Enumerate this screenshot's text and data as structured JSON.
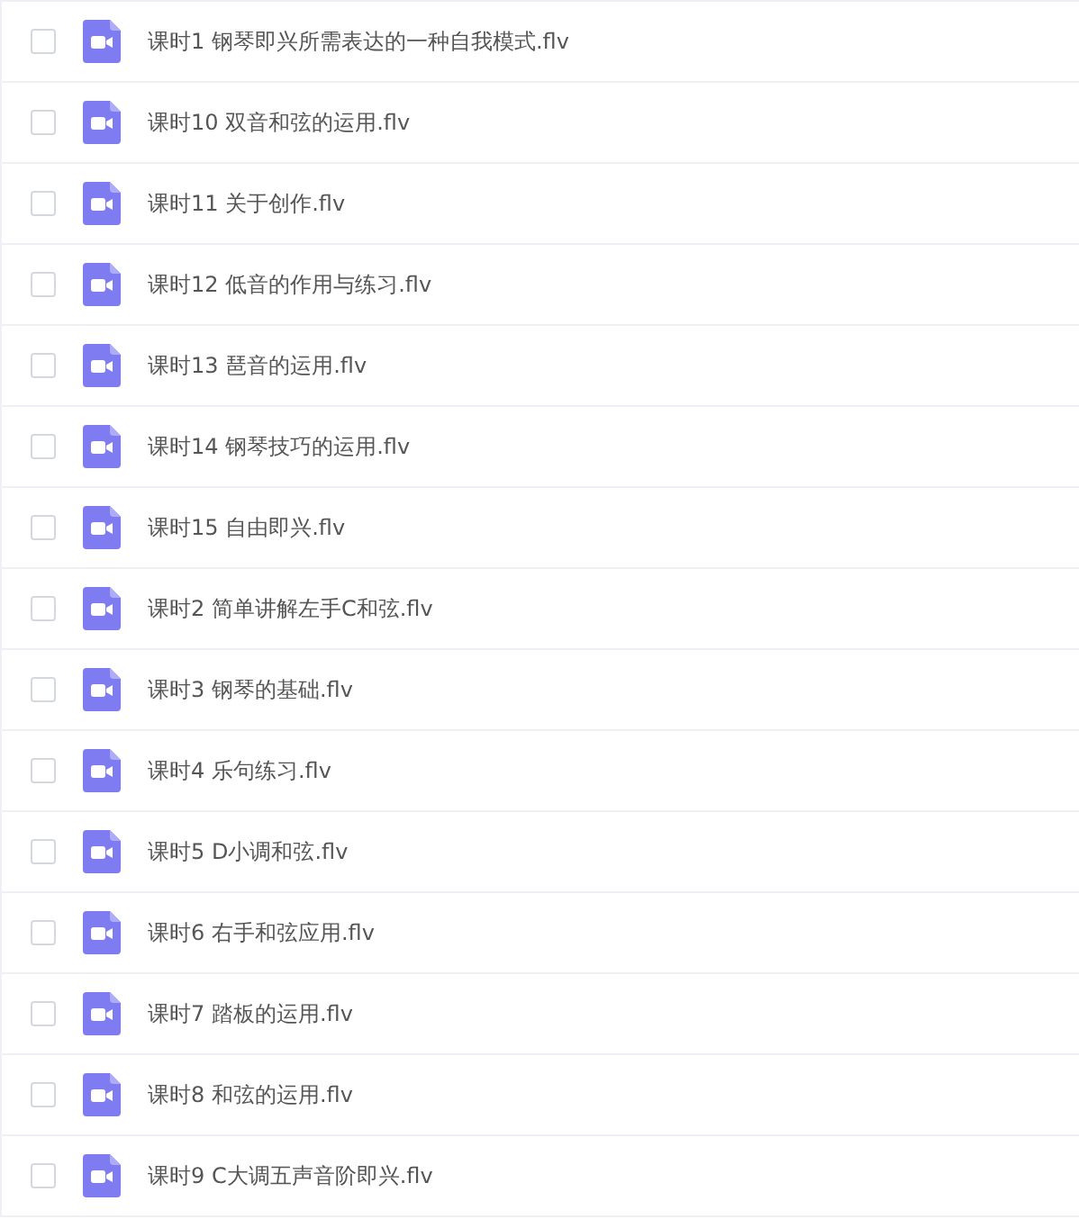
{
  "files": [
    {
      "name": "课时1 钢琴即兴所需表达的一种自我模式.flv",
      "checked": false
    },
    {
      "name": "课时10 双音和弦的运用.flv",
      "checked": false
    },
    {
      "name": "课时11 关于创作.flv",
      "checked": false
    },
    {
      "name": "课时12 低音的作用与练习.flv",
      "checked": false
    },
    {
      "name": "课时13 琶音的运用.flv",
      "checked": false
    },
    {
      "name": "课时14 钢琴技巧的运用.flv",
      "checked": false
    },
    {
      "name": "课时15 自由即兴.flv",
      "checked": false
    },
    {
      "name": "课时2 简单讲解左手C和弦.flv",
      "checked": false
    },
    {
      "name": "课时3 钢琴的基础.flv",
      "checked": false
    },
    {
      "name": "课时4 乐句练习.flv",
      "checked": false
    },
    {
      "name": "课时5 D小调和弦.flv",
      "checked": false
    },
    {
      "name": "课时6 右手和弦应用.flv",
      "checked": false
    },
    {
      "name": "课时7 踏板的运用.flv",
      "checked": false
    },
    {
      "name": "课时8 和弦的运用.flv",
      "checked": false
    },
    {
      "name": "课时9 C大调五声音阶即兴.flv",
      "checked": false
    }
  ]
}
